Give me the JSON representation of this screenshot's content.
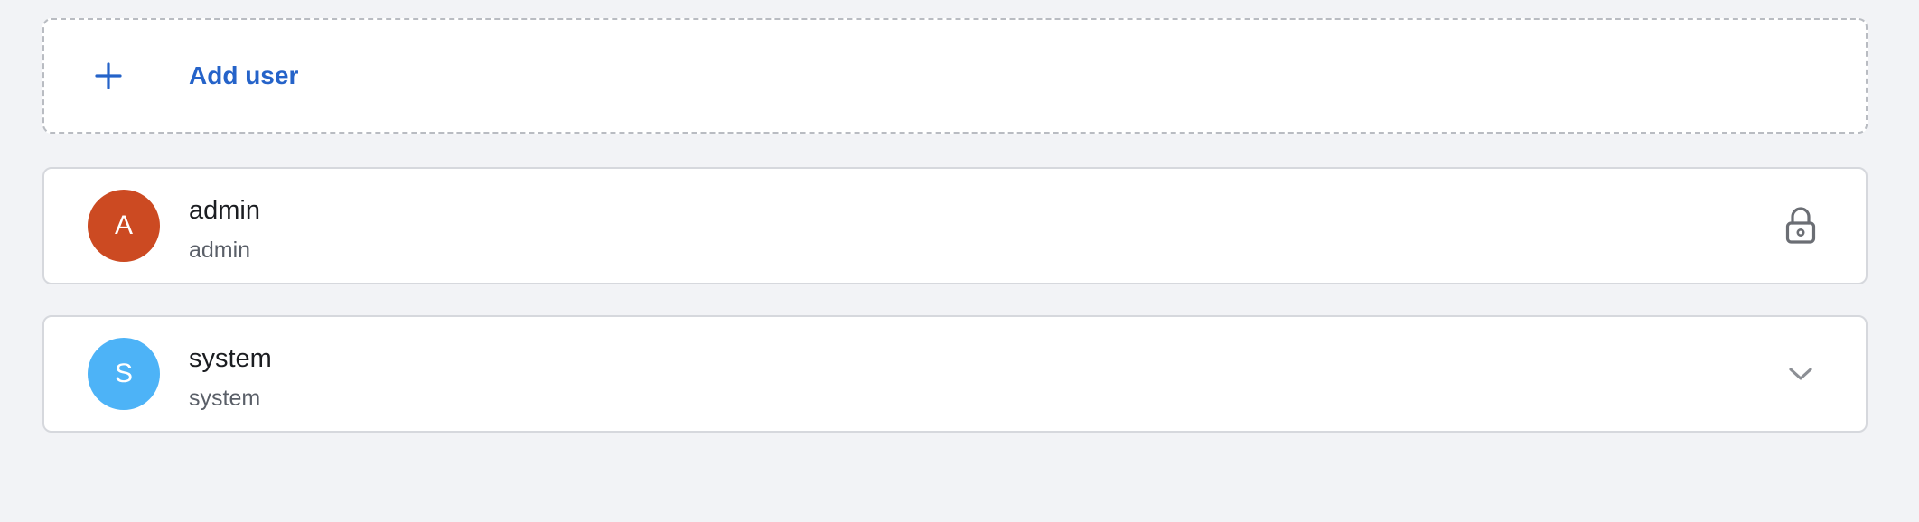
{
  "add_user": {
    "label": "Add user",
    "icon": "plus-icon",
    "accent_color": "#2563c9"
  },
  "users": [
    {
      "initial": "A",
      "name": "admin",
      "role": "admin",
      "avatar_color": "#cc4a22",
      "trailing_icon": "lock-icon"
    },
    {
      "initial": "S",
      "name": "system",
      "role": "system",
      "avatar_color": "#4db3f7",
      "trailing_icon": "chevron-down-icon"
    }
  ]
}
